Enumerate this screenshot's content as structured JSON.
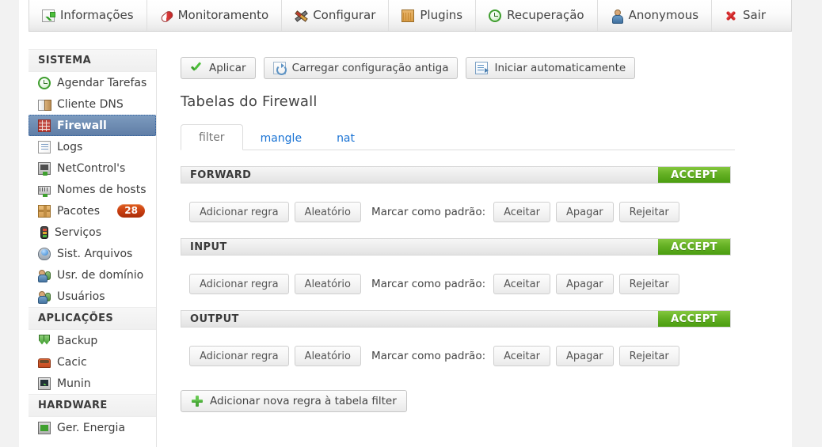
{
  "topnav": {
    "items": [
      {
        "label": "Informações",
        "icon": "chart-icon"
      },
      {
        "label": "Monitoramento",
        "icon": "pill-icon"
      },
      {
        "label": "Configurar",
        "icon": "tools-icon"
      },
      {
        "label": "Plugins",
        "icon": "box-icon"
      },
      {
        "label": "Recuperação",
        "icon": "clock-icon"
      },
      {
        "label": "Anonymous",
        "icon": "user-icon"
      },
      {
        "label": "Sair",
        "icon": "close-x-icon"
      }
    ]
  },
  "sidebar": {
    "sections": [
      {
        "title": "SISTEMA",
        "items": [
          {
            "label": "Agendar Tarefas",
            "icon": "clock-icon",
            "active": false
          },
          {
            "label": "Cliente DNS",
            "icon": "book-icon",
            "active": false
          },
          {
            "label": "Firewall",
            "icon": "brick-wall-icon",
            "active": true
          },
          {
            "label": "Logs",
            "icon": "log-file-icon",
            "active": false
          },
          {
            "label": "NetControl's",
            "icon": "network-icon",
            "active": false
          },
          {
            "label": "Nomes de hosts",
            "icon": "hosts-icon",
            "active": false
          },
          {
            "label": "Pacotes",
            "icon": "package-icon",
            "active": false,
            "badge": "28"
          },
          {
            "label": "Serviços",
            "icon": "traffic-light-icon",
            "active": false
          },
          {
            "label": "Sist. Arquivos",
            "icon": "disk-icon",
            "active": false
          },
          {
            "label": "Usr. de domínio",
            "icon": "users-icon",
            "active": false
          },
          {
            "label": "Usuários",
            "icon": "users-icon",
            "active": false
          }
        ]
      },
      {
        "title": "APLICAÇÕES",
        "items": [
          {
            "label": "Backup",
            "icon": "backup-icon",
            "active": false
          },
          {
            "label": "Cacic",
            "icon": "cacic-icon",
            "active": false
          },
          {
            "label": "Munin",
            "icon": "munin-icon",
            "active": false
          }
        ]
      },
      {
        "title": "HARDWARE",
        "items": [
          {
            "label": "Ger. Energia",
            "icon": "power-icon",
            "active": false
          }
        ]
      }
    ]
  },
  "toolbar": {
    "buttons": [
      {
        "label": "Aplicar",
        "icon": "check-icon"
      },
      {
        "label": "Carregar configuração antiga",
        "icon": "reload-icon"
      },
      {
        "label": "Iniciar automaticamente",
        "icon": "document-arrow-icon"
      }
    ]
  },
  "page": {
    "title": "Tabelas do Firewall",
    "add_rule_button": "Adicionar nova regra à tabela filter",
    "add_rule_icon": "plus-icon"
  },
  "tabs": [
    {
      "label": "filter",
      "active": true
    },
    {
      "label": "mangle",
      "active": false
    },
    {
      "label": "nat",
      "active": false
    }
  ],
  "mark_as_default_label": "Marcar como padrão:",
  "chain_buttons": {
    "add_rule": "Adicionar regra",
    "random": "Aleatório",
    "accept": "Aceitar",
    "delete": "Apagar",
    "reject": "Rejeitar"
  },
  "chains": [
    {
      "name": "FORWARD",
      "policy": "ACCEPT"
    },
    {
      "name": "INPUT",
      "policy": "ACCEPT"
    },
    {
      "name": "OUTPUT",
      "policy": "ACCEPT"
    }
  ],
  "colors": {
    "accent_blue": "#1a73d4",
    "policy_green": "#4a9d0f",
    "badge_orange": "#c63c10",
    "selected_blue": "#6e8cb2"
  }
}
